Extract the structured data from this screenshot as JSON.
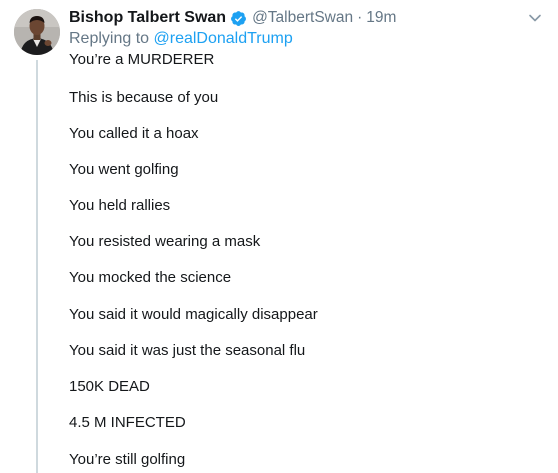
{
  "tweet": {
    "display_name": "Bishop Talbert Swan",
    "handle": "@TalbertSwan",
    "separator": "·",
    "timestamp": "19m",
    "replying_prefix": "Replying to ",
    "replying_to": "@realDonaldTrump",
    "lines": [
      "You’re a MURDERER",
      "This is because of you",
      "You called it a hoax",
      "You went golfing",
      "You held rallies",
      "You resisted wearing a mask",
      "You mocked the science",
      "You said it would magically disappear",
      "You said it was just the seasonal flu",
      "150K DEAD",
      "4.5 M INFECTED",
      "You’re still golfing"
    ]
  },
  "colors": {
    "verified_blue": "#1da1f2",
    "secondary_text": "#657786",
    "primary_text": "#14171a",
    "thread_line": "#cfd9de"
  },
  "icons": {
    "verified": "verified-badge-icon",
    "menu": "chevron-down-icon",
    "avatar": "profile-avatar"
  }
}
